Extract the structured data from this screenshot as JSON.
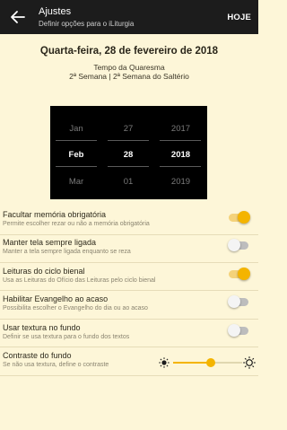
{
  "header": {
    "title": "Ajustes",
    "subtitle": "Definir opções para o iLiturgia",
    "today_label": "HOJE"
  },
  "date_info": {
    "date": "Quarta-feira, 28 de fevereiro de 2018",
    "season": "Tempo da Quaresma",
    "week": "2ª Semana | 2ª Semana do Saltério"
  },
  "date_picker": {
    "month": {
      "prev": "Jan",
      "current": "Feb",
      "next": "Mar"
    },
    "day": {
      "prev": "27",
      "current": "28",
      "next": "01"
    },
    "year": {
      "prev": "2017",
      "current": "2018",
      "next": "2019"
    }
  },
  "settings": [
    {
      "label": "Facultar memória obrigatória",
      "description": "Permite escolher rezar ou não a memória obrigatória",
      "enabled": true
    },
    {
      "label": "Manter tela sempre ligada",
      "description": "Manter a tela sempre ligada enquanto se reza",
      "enabled": false
    },
    {
      "label": "Leituras do ciclo bienal",
      "description": "Usa as Leituras do Ofício das Leituras pelo ciclo bienal",
      "enabled": true
    },
    {
      "label": "Habilitar Evangelho ao acaso",
      "description": "Possibilita escolher o Evangelho do dia ou ao acaso",
      "enabled": false
    },
    {
      "label": "Usar textura no fundo",
      "description": "Definir se usa textura para o fundo dos textos",
      "enabled": false
    }
  ],
  "contrast": {
    "label": "Contraste do fundo",
    "description": "Se não usa textura, define o contraste",
    "level": 0.55
  },
  "colors": {
    "accent": "#f4b400",
    "background": "#fdf6d8",
    "appbar": "#1c1c1c"
  },
  "icons": {
    "back": "arrow-left-icon",
    "contrast_low": "sun-small-icon",
    "contrast_high": "sun-large-icon"
  }
}
